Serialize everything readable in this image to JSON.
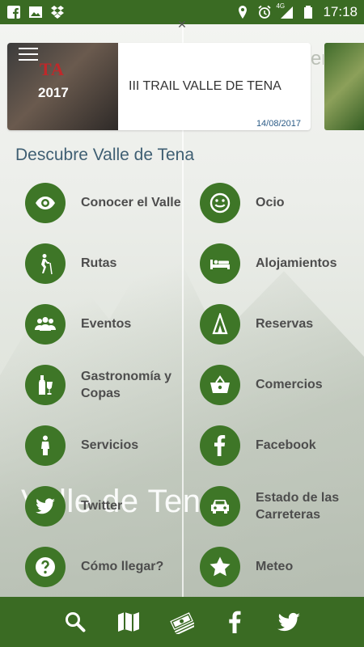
{
  "status_bar": {
    "time": "17:18",
    "network": "4G",
    "left_icons": [
      "facebook-icon",
      "image-icon",
      "dropbox-icon"
    ],
    "right_icons": [
      "location-icon",
      "alarm-icon",
      "signal-icon",
      "battery-icon"
    ]
  },
  "carousel": {
    "title": "III TRAIL VALLE DE TENA",
    "date": "14/08/2017",
    "thumb_logo": "TA",
    "thumb_year": "2017",
    "peek_text": "er"
  },
  "section": {
    "title": "Descubre Valle de Tena"
  },
  "menu": [
    {
      "label": "Conocer el Valle",
      "icon": "eye-icon"
    },
    {
      "label": "Ocio",
      "icon": "smiley-icon"
    },
    {
      "label": "Rutas",
      "icon": "hiker-icon"
    },
    {
      "label": "Alojamientos",
      "icon": "bed-icon"
    },
    {
      "label": "Eventos",
      "icon": "group-icon"
    },
    {
      "label": "Reservas",
      "icon": "tent-icon"
    },
    {
      "label": "Gastronomía y Copas",
      "icon": "bottle-glass-icon"
    },
    {
      "label": "Comercios",
      "icon": "basket-icon"
    },
    {
      "label": "Servicios",
      "icon": "person-icon"
    },
    {
      "label": "Facebook",
      "icon": "facebook-icon"
    },
    {
      "label": "Twitter",
      "icon": "twitter-icon"
    },
    {
      "label": "Estado de las Carreteras",
      "icon": "car-icon"
    },
    {
      "label": "Cómo llegar?",
      "icon": "question-icon"
    },
    {
      "label": "Meteo",
      "icon": "star-icon"
    }
  ],
  "background": {
    "watermark": "Valle de Tena"
  },
  "bottom_bar": [
    "search-icon",
    "map-icon",
    "money-icon",
    "facebook-icon",
    "twitter-icon"
  ],
  "colors": {
    "brand_green": "#3a6b23",
    "circle_green": "#3e7627",
    "title_blue": "#3f5f73",
    "date_blue": "#2b5b86"
  }
}
